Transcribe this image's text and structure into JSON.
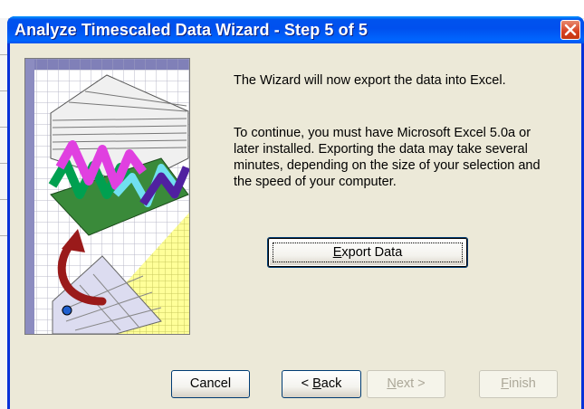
{
  "window": {
    "title": "Analyze Timescaled Data Wizard - Step 5 of 5",
    "close_icon": "close-icon"
  },
  "content": {
    "message_1": "The Wizard will now export the data into Excel.",
    "message_2": "To continue, you must have Microsoft Excel 5.0a or later installed.  Exporting the data may take several minutes, depending on the size of your selection and the speed of your computer.",
    "illustration_icon": "wizard-chart-illustration"
  },
  "buttons": {
    "export_prefix": "",
    "export_mnemonic": "E",
    "export_rest": "xport Data",
    "cancel": "Cancel",
    "back_prefix": "< ",
    "back_mnemonic": "B",
    "back_rest": "ack",
    "next_prefix": "",
    "next_mnemonic": "N",
    "next_rest": "ext >",
    "finish_prefix": "",
    "finish_mnemonic": "F",
    "finish_rest": "inish"
  },
  "colors": {
    "titlebar": "#0054e3",
    "dialog_face": "#ece9d8",
    "disabled_text": "#aca899"
  }
}
